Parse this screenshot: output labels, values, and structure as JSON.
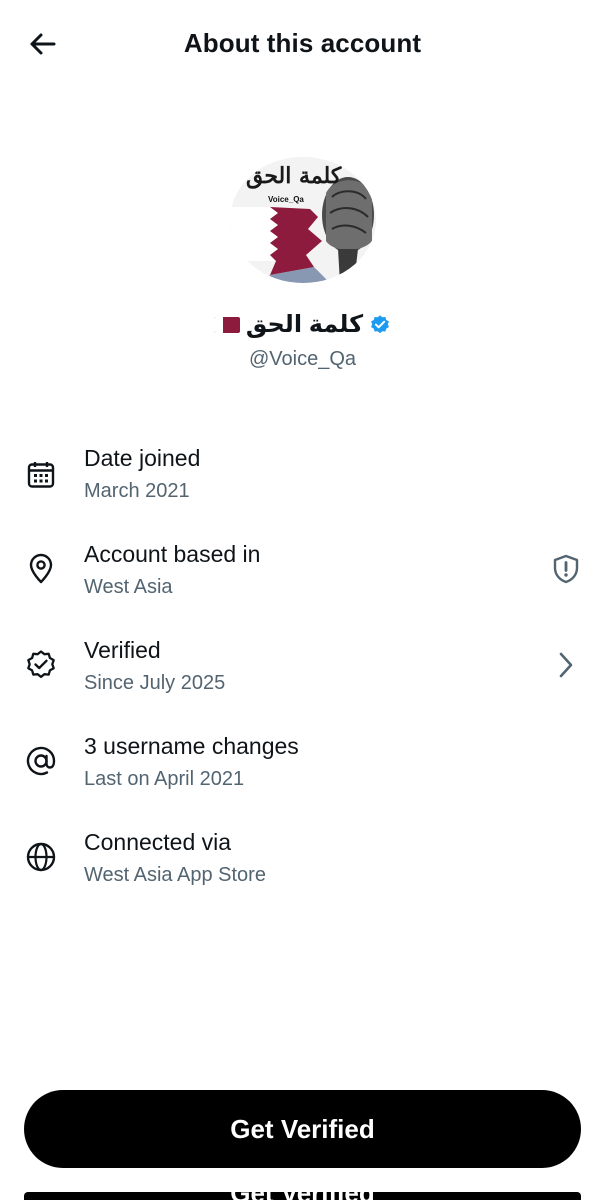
{
  "header": {
    "title": "About this account",
    "back_icon": "arrow-left-icon"
  },
  "profile": {
    "avatar_caption": "كلمة الحق",
    "avatar_small_text": "Voice_Qa",
    "display_name": "كلمة الحق",
    "handle": "@Voice_Qa",
    "verified_color": "#1d9bf0",
    "flag_color": "#8d1b3d"
  },
  "rows": [
    {
      "icon": "calendar-icon",
      "title": "Date joined",
      "subtitle": "March 2021"
    },
    {
      "icon": "location-pin-icon",
      "title": "Account based in",
      "subtitle": "West Asia",
      "trailing_icon": "shield-alert-icon"
    },
    {
      "icon": "verified-badge-icon",
      "title": "Verified",
      "subtitle": "Since July 2025",
      "trailing_icon": "chevron-right-icon"
    },
    {
      "icon": "at-sign-icon",
      "title": "3 username changes",
      "subtitle": "Last on April 2021"
    },
    {
      "icon": "globe-icon",
      "title": "Connected via",
      "subtitle": "West Asia App Store"
    }
  ],
  "cta": {
    "label": "Get Verified",
    "background": "#000000"
  }
}
